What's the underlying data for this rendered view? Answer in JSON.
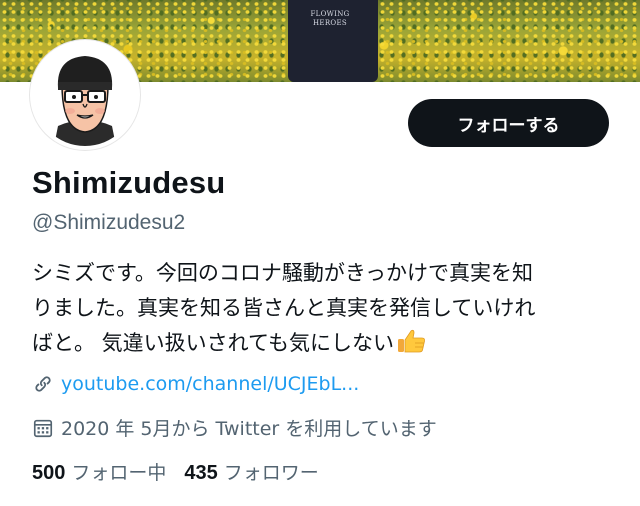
{
  "profile": {
    "display_name": "Shimizudesu",
    "handle": "@Shimizudesu2",
    "bio_lines": [
      "シミズです。今回のコロナ騒動がきっかけで真実を知",
      "りました。真実を知る皆さんと真実を発信していけれ",
      "ばと。 気違い扱いされても気にしない"
    ],
    "bio_emoji": "thumbs-up-icon",
    "link_text": "youtube.com/channel/UCJEbL...",
    "joined_text": "2020 年 5月から Twitter を利用しています"
  },
  "actions": {
    "follow_label": "フォローする"
  },
  "stats": {
    "following_count": "500",
    "following_label": "フォロー中",
    "followers_count": "435",
    "followers_label": "フォロワー"
  },
  "banner": {
    "shirt_text": "FLOWING HEROES"
  },
  "colors": {
    "primary_text": "#0f1419",
    "secondary_text": "#536471",
    "link": "#1d9bf0",
    "button_bg": "#0f1419",
    "button_text": "#ffffff"
  }
}
